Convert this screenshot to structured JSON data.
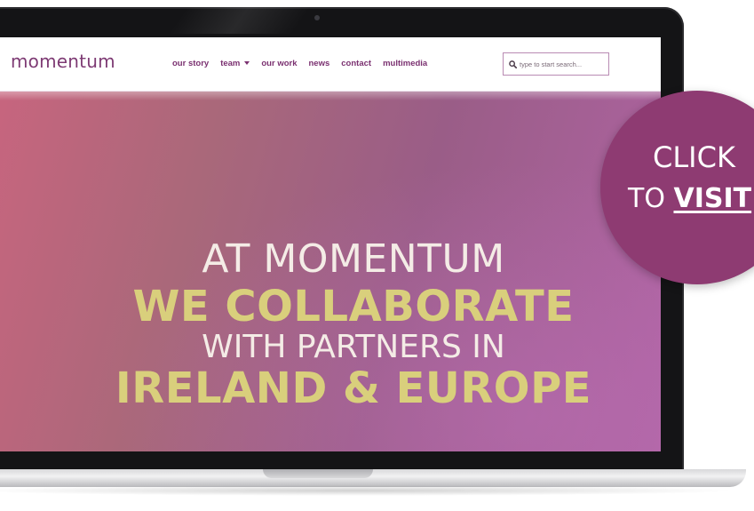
{
  "site": {
    "logo": "momentum",
    "nav": [
      {
        "label": "our story",
        "has_dropdown": false
      },
      {
        "label": "team",
        "has_dropdown": true
      },
      {
        "label": "our work",
        "has_dropdown": false
      },
      {
        "label": "news",
        "has_dropdown": false
      },
      {
        "label": "contact",
        "has_dropdown": false
      },
      {
        "label": "multimedia",
        "has_dropdown": false
      }
    ],
    "search": {
      "placeholder": "type to start search...",
      "icon": "search-icon"
    }
  },
  "hero": {
    "line1": "AT MOMENTUM",
    "line2": "WE COLLABORATE",
    "line3": "WITH PARTNERS IN",
    "line4": "IRELAND & EUROPE"
  },
  "cta": {
    "line1": "CLICK",
    "line2_prefix": "TO ",
    "line2_link": "VISIT"
  },
  "colors": {
    "brand_purple": "#7e3b74",
    "cta_purple": "#8e3b72",
    "hero_gold": "#d9cf7c",
    "hero_cream": "#f4ece6"
  }
}
